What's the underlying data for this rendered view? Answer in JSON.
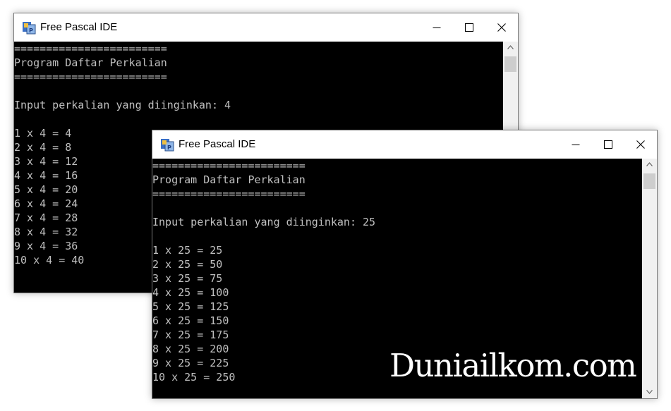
{
  "window_back": {
    "title": "Free Pascal IDE",
    "console_lines": [
      "========================",
      "Program Daftar Perkalian",
      "========================",
      "",
      "Input perkalian yang diinginkan: 4",
      "",
      "1 x 4 = 4",
      "2 x 4 = 8",
      "3 x 4 = 12",
      "4 x 4 = 16",
      "5 x 4 = 20",
      "6 x 4 = 24",
      "7 x 4 = 28",
      "8 x 4 = 32",
      "9 x 4 = 36",
      "10 x 4 = 40"
    ]
  },
  "window_front": {
    "title": "Free Pascal IDE",
    "console_lines": [
      "========================",
      "Program Daftar Perkalian",
      "========================",
      "",
      "Input perkalian yang diinginkan: 25",
      "",
      "1 x 25 = 25",
      "2 x 25 = 50",
      "3 x 25 = 75",
      "4 x 25 = 100",
      "5 x 25 = 125",
      "6 x 25 = 150",
      "7 x 25 = 175",
      "8 x 25 = 200",
      "9 x 25 = 225",
      "10 x 25 = 250"
    ]
  },
  "watermark": "Duniailkom.com",
  "icons": {
    "app": "free-pascal-icon",
    "minimize": "minimize-icon",
    "maximize": "maximize-icon",
    "close": "close-icon",
    "scroll_up": "scroll-up-arrow-icon",
    "scroll_down": "scroll-down-arrow-icon"
  },
  "colors": {
    "console_bg": "#000000",
    "console_text": "#c0c0c0",
    "titlebar_bg": "#ffffff",
    "scrollbar_bg": "#f0f0f0",
    "scroll_thumb": "#cdcdcd",
    "watermark": "#ffffff"
  }
}
